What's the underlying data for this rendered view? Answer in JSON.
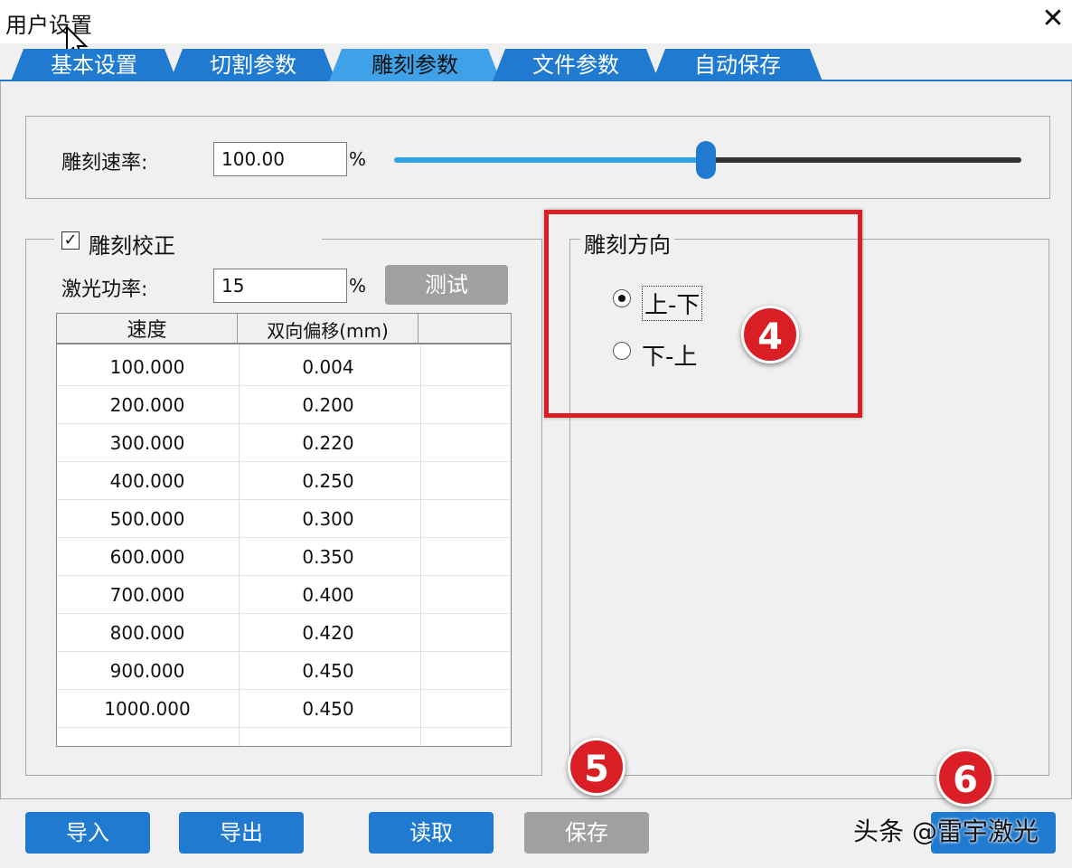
{
  "window": {
    "title": "用户设置",
    "close_glyph": "✕"
  },
  "tabs": [
    {
      "label": "基本设置",
      "active": false
    },
    {
      "label": "切割参数",
      "active": false
    },
    {
      "label": "雕刻参数",
      "active": true
    },
    {
      "label": "文件参数",
      "active": false
    },
    {
      "label": "自动保存",
      "active": false
    }
  ],
  "engrave_speed": {
    "label": "雕刻速率:",
    "value": "100.00",
    "unit": "%",
    "slider_level": 0.5
  },
  "correction": {
    "checkbox_label": "雕刻校正",
    "checked": true,
    "check_glyph": "✓",
    "laser_power_label": "激光功率:",
    "laser_power_value": "15",
    "unit": "%",
    "test_button": "测试",
    "table": {
      "headers": [
        "速度",
        "双向偏移(mm)"
      ],
      "rows": [
        [
          "100.000",
          "0.004"
        ],
        [
          "200.000",
          "0.200"
        ],
        [
          "300.000",
          "0.220"
        ],
        [
          "400.000",
          "0.250"
        ],
        [
          "500.000",
          "0.300"
        ],
        [
          "600.000",
          "0.350"
        ],
        [
          "700.000",
          "0.400"
        ],
        [
          "800.000",
          "0.420"
        ],
        [
          "900.000",
          "0.450"
        ],
        [
          "1000.000",
          "0.450"
        ]
      ]
    }
  },
  "direction": {
    "legend": "雕刻方向",
    "options": [
      {
        "label": "上-下",
        "selected": true
      },
      {
        "label": "下-上",
        "selected": false
      }
    ]
  },
  "footer": {
    "import": "导入",
    "export": "导出",
    "read": "读取",
    "save": "保存"
  },
  "badges": [
    "4",
    "5",
    "6"
  ],
  "watermark": "头条 @雷宇激光",
  "colors": {
    "tab_blue": "#1f7ad0",
    "tab_active": "#3fa2e8",
    "highlight_red": "#d91e25",
    "disabled_gray": "#a0a0a0"
  }
}
